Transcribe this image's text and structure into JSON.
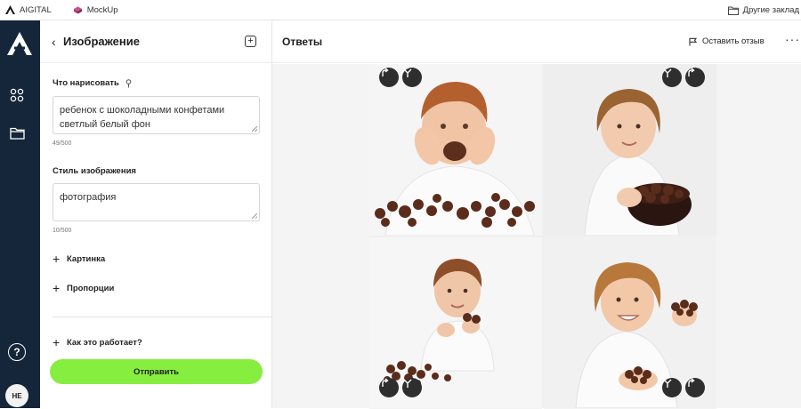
{
  "bookmarks": {
    "items": [
      {
        "label": "AIGITAL",
        "icon": "aigital-logo-icon"
      },
      {
        "label": "MockUp",
        "icon": "mockup-icon"
      }
    ],
    "other": {
      "label": "Другие заклад",
      "icon": "folder-icon"
    }
  },
  "rail": {
    "items": [
      "apps-grid-icon",
      "folder-icon"
    ],
    "help": "?",
    "avatar": "НЕ"
  },
  "panel": {
    "title": "Изображение",
    "prompt": {
      "label": "Что нарисовать",
      "value": "ребенок с шоколадными конфетами светлый белый фон",
      "counter": "49/500"
    },
    "style": {
      "label": "Стиль изображения",
      "value": "фотография",
      "counter": "10/500"
    },
    "expanders": {
      "picture": "Картинка",
      "proportions": "Пропорции",
      "how_it_works": "Как это работает?"
    },
    "submit": "Отправить"
  },
  "answers": {
    "title": "Ответы",
    "feedback": "Оставить отзыв",
    "more": "···"
  },
  "colors": {
    "rail": "#15263a",
    "accent": "#86ee3f",
    "image_button": "#2e2e2e"
  }
}
